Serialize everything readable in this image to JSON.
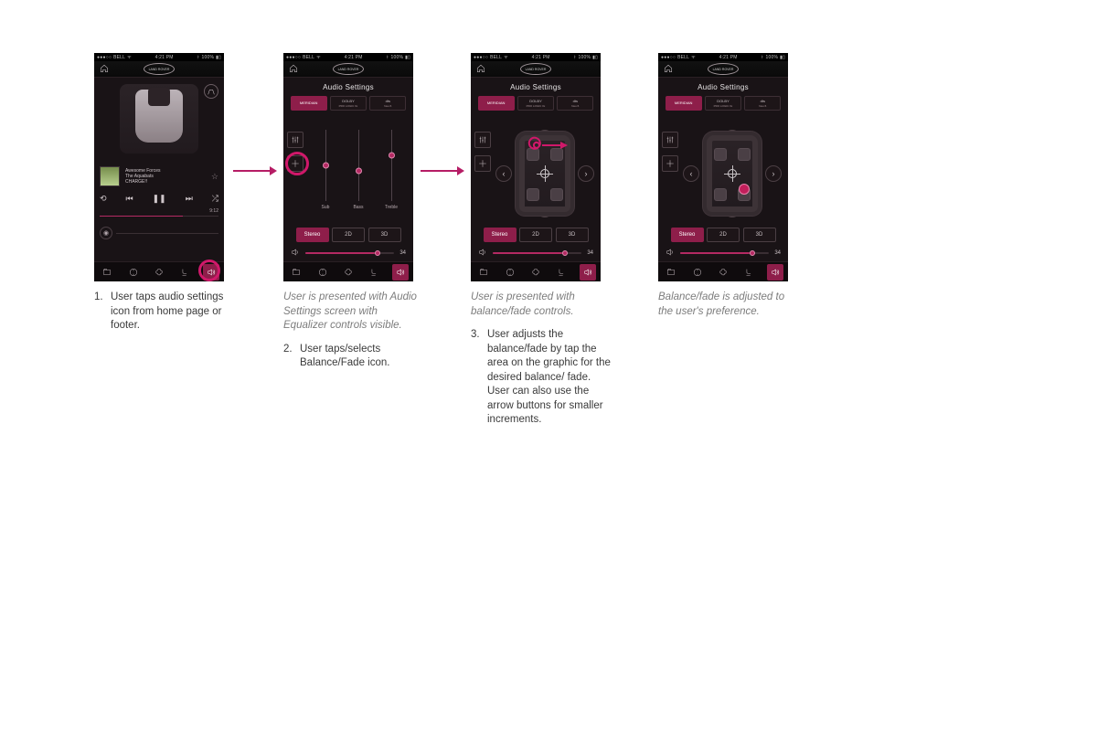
{
  "statusbar": {
    "carrier": "BELL",
    "time": "4:21 PM",
    "battery": "100%"
  },
  "brand_badge": "LAND ROVER",
  "audio_settings_title": "Audio Settings",
  "brand_tabs": [
    {
      "label": "MERIDIAN",
      "sub": ""
    },
    {
      "label": "DOLBY",
      "sub": "PRO LOGIC IIx"
    },
    {
      "label": "dts",
      "sub": "Neo:6"
    }
  ],
  "eq": {
    "channels": [
      {
        "label": "Sub",
        "pos": 0.5
      },
      {
        "label": "Bass",
        "pos": 0.42
      },
      {
        "label": "Treble",
        "pos": 0.64
      }
    ]
  },
  "mode_tabs": [
    {
      "label": "Stereo",
      "active": true
    },
    {
      "label": "2D",
      "active": false
    },
    {
      "label": "3D",
      "active": false
    }
  ],
  "volume": {
    "value": 34,
    "fill_pct": 78
  },
  "home_screen": {
    "track_title": "Awesome Forces",
    "track_artist": "The Aquabats",
    "track_album": "CHARGE!!",
    "elapsed": "9:12",
    "progress_pct": 70
  },
  "captions": {
    "c1_step": "1.",
    "c1_text": "User taps audio settings icon from home page or footer.",
    "c2_gray": "User is presented with Audio Settings screen with Equalizer controls visible.",
    "c2_step": "2.",
    "c2_text": "User taps/selects Balance/Fade icon.",
    "c3_gray": "User is presented with balance/fade controls.",
    "c3_step": "3.",
    "c3_text": "User adjusts the balance/fade by tap the area on the graphic for the desired balance/ fade. User can also use the arrow buttons for smaller increments.",
    "c4_gray": "Balance/fade is adjusted to the user's preference."
  }
}
